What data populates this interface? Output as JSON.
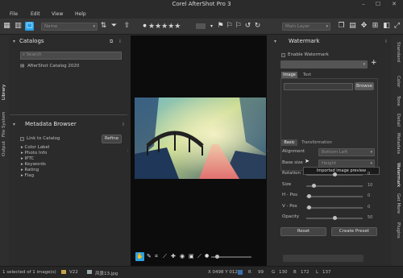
{
  "app": {
    "title": "Corel AfterShot Pro 3"
  },
  "menu": [
    "File",
    "Edit",
    "View",
    "Help"
  ],
  "toolbar": {
    "name_dropdown": "Name",
    "layer_dropdown": "Main Layer",
    "stars": "★★★★★"
  },
  "left_tabs": {
    "library": "Library",
    "file_system": "File System",
    "output": "Output"
  },
  "catalogs": {
    "title": "Catalogs",
    "search_placeholder": "Search",
    "items": [
      "AfterShot Catalog 2020"
    ]
  },
  "metadata": {
    "title": "Metadata Browser",
    "link_label": "Link to Catalog",
    "refine": "Refine",
    "items": [
      "Color Label",
      "Photo Info",
      "IPTC",
      "Keywords",
      "Rating",
      "Flag"
    ]
  },
  "watermark": {
    "title": "Watermark",
    "enable_label": "Enable Watermark",
    "tabs": {
      "image": "Image",
      "text": "Text"
    },
    "browse": "Browse",
    "preview_tooltip": "Imported image preview",
    "subtabs": {
      "basic": "Basic",
      "transformation": "Transformation"
    },
    "alignment": {
      "label": "Alignment",
      "value": "Bottom Left"
    },
    "base_size": {
      "label": "Base size",
      "value": "Height"
    },
    "sliders": [
      {
        "label": "Rotation",
        "value": "0",
        "level": 0.5
      },
      {
        "label": "Size",
        "value": "10",
        "level": 0.1
      },
      {
        "label": "H - Pos",
        "value": "0",
        "level": 0.02
      },
      {
        "label": "V - Pos",
        "value": "0",
        "level": 0.02
      },
      {
        "label": "Opacity",
        "value": "50",
        "level": 0.5
      }
    ],
    "reset": "Reset",
    "create_preset": "Create Preset"
  },
  "right_tabs": [
    "Standard",
    "Color",
    "Tone",
    "Detail",
    "Metadata",
    "Watermark",
    "Get More",
    "Plugins"
  ],
  "status": {
    "selection": "1 selected of 1 image(s)",
    "folder": "V22",
    "file": "风景13.jpg",
    "coords": "X 0498  Y 0120",
    "r_label": "R",
    "r": "99",
    "g_label": "G",
    "g": "130",
    "b_label": "B",
    "b": "172",
    "l_label": "L",
    "l": "137"
  },
  "colors": {
    "accent": "#29a3e8",
    "panel": "#2b2b2b",
    "canvas": "#0c0c0c"
  }
}
